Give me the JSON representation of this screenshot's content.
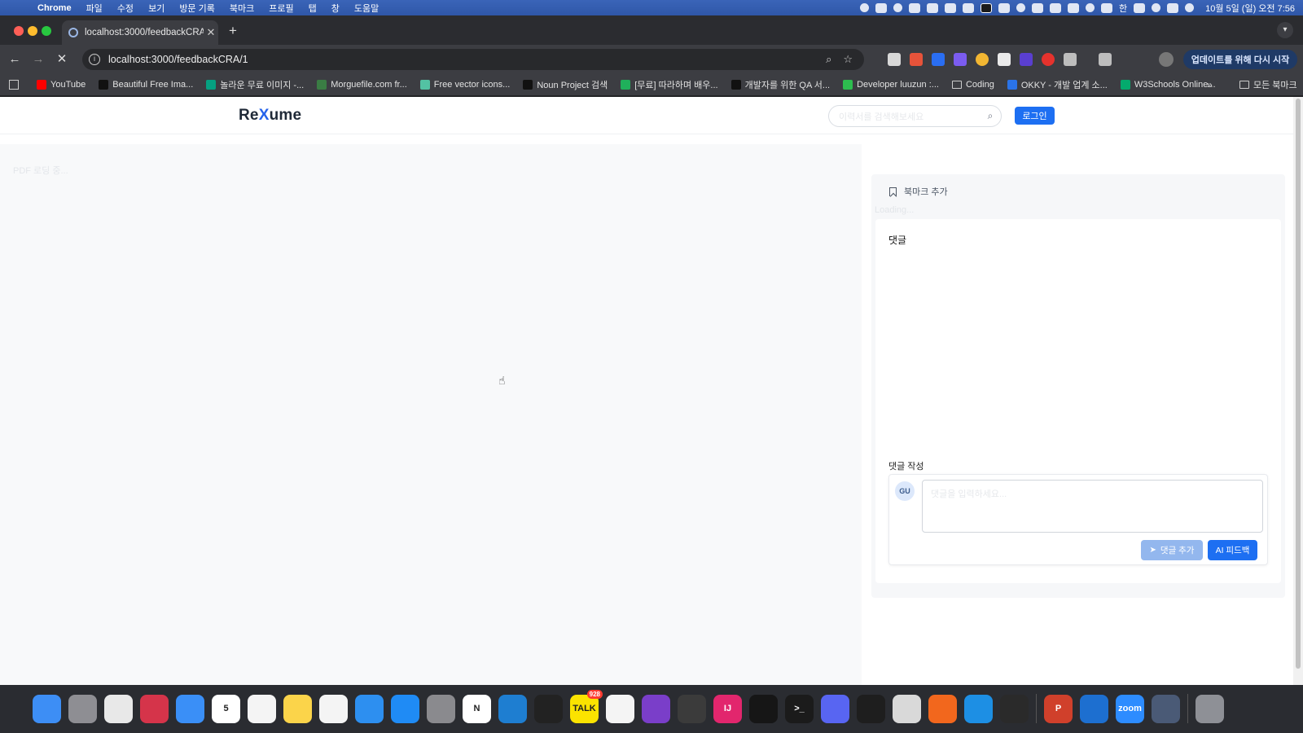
{
  "menubar": {
    "app": "Chrome",
    "items": [
      "파일",
      "수정",
      "보기",
      "방문 기록",
      "북마크",
      "프로필",
      "탭",
      "창",
      "도움말"
    ],
    "clock": "10월 5일 (일) 오전 7:56",
    "input_source": "한"
  },
  "browser": {
    "tab_title": "localhost:3000/feedbackCRA/",
    "url": "localhost:3000/feedbackCRA/1",
    "update_button": "업데이트를 위해 다시 시작",
    "bookmarks": [
      {
        "label": "YouTube",
        "color": "#ff0000"
      },
      {
        "label": "Beautiful Free Ima...",
        "color": "#111111"
      },
      {
        "label": "놀라운 무료 이미지 -...",
        "color": "#05a081"
      },
      {
        "label": "Morguefile.com fr...",
        "color": "#3a7d44"
      },
      {
        "label": "Free vector icons...",
        "color": "#53c2a3"
      },
      {
        "label": "Noun Project 검색",
        "color": "#111111"
      },
      {
        "label": "[무료] 따라하며 배우...",
        "color": "#20b05b"
      },
      {
        "label": "개발자를 위한 QA 서...",
        "color": "#111111"
      },
      {
        "label": "Developer luuzun :...",
        "color": "#2dbd4f"
      },
      {
        "label": "Coding",
        "color": "folder"
      },
      {
        "label": "OKKY - 개발 업계 소...",
        "color": "#2a73e8"
      },
      {
        "label": "W3Schools Online...",
        "color": "#04aa6d"
      }
    ],
    "all_bookmarks": "모든 북마크"
  },
  "site": {
    "logo_prefix": "Re",
    "logo_x": "X",
    "logo_suffix": "ume",
    "search_placeholder": "이력서를 검색해보세요",
    "login": "로그인"
  },
  "pdf": {
    "loading": "PDF 로딩 중..."
  },
  "sidebar": {
    "bookmark_add": "북마크 추가",
    "loading": "Loading...",
    "comments_title": "댓글",
    "write_label": "댓글 작성",
    "avatar": "GU",
    "comment_placeholder": "댓글을 입력하세요...",
    "add_comment": "댓글 추가",
    "ai_feedback": "AI 피드백"
  },
  "dock": {
    "apps": [
      {
        "name": "finder",
        "color": "#3d8ef5"
      },
      {
        "name": "launchpad",
        "color": "#8e8e93"
      },
      {
        "name": "chrome",
        "color": "#e8e8e8"
      },
      {
        "name": "photo-booth",
        "color": "#d5344a"
      },
      {
        "name": "mail",
        "color": "#3a8ff7"
      },
      {
        "name": "calendar",
        "color": "#ffffff",
        "label": "5"
      },
      {
        "name": "reminders",
        "color": "#f4f4f4"
      },
      {
        "name": "notes",
        "color": "#fbd44a"
      },
      {
        "name": "freeform",
        "color": "#f4f4f4"
      },
      {
        "name": "keynote",
        "color": "#2d8ff0"
      },
      {
        "name": "app-store",
        "color": "#1f8bf5"
      },
      {
        "name": "system-settings",
        "color": "#8a8a8e"
      },
      {
        "name": "notion",
        "color": "#ffffff",
        "label": "N"
      },
      {
        "name": "vscode",
        "color": "#1e7ed1"
      },
      {
        "name": "unity",
        "color": "#222222"
      },
      {
        "name": "kakaotalk",
        "color": "#fbe300",
        "label": "TALK",
        "badge": "928"
      },
      {
        "name": "slack",
        "color": "#f4f4f4"
      },
      {
        "name": "github-desktop",
        "color": "#7a3ec9"
      },
      {
        "name": "chatgpt-like",
        "color": "#3b3b3b"
      },
      {
        "name": "intellij",
        "color": "#e2266d",
        "label": "IJ"
      },
      {
        "name": "sequel",
        "color": "#161616"
      },
      {
        "name": "terminal",
        "color": "#1b1b1b",
        "label": ">_"
      },
      {
        "name": "discord",
        "color": "#5865f2"
      },
      {
        "name": "figma",
        "color": "#1e1e1e"
      },
      {
        "name": "blocked-app",
        "color": "#d9d9d9"
      },
      {
        "name": "pencil-app",
        "color": "#f2671d"
      },
      {
        "name": "docker",
        "color": "#1d8fe4"
      },
      {
        "name": "openai",
        "color": "#2a2a2a"
      },
      {
        "name": "powerpoint",
        "color": "#d0402b",
        "label": "P"
      },
      {
        "name": "outlook",
        "color": "#1d6fd0"
      },
      {
        "name": "zoom",
        "color": "#2d8cff",
        "label": "zoom"
      },
      {
        "name": "preview",
        "color": "#4a5a76"
      },
      {
        "name": "trash",
        "color": "#8e9096"
      }
    ]
  }
}
